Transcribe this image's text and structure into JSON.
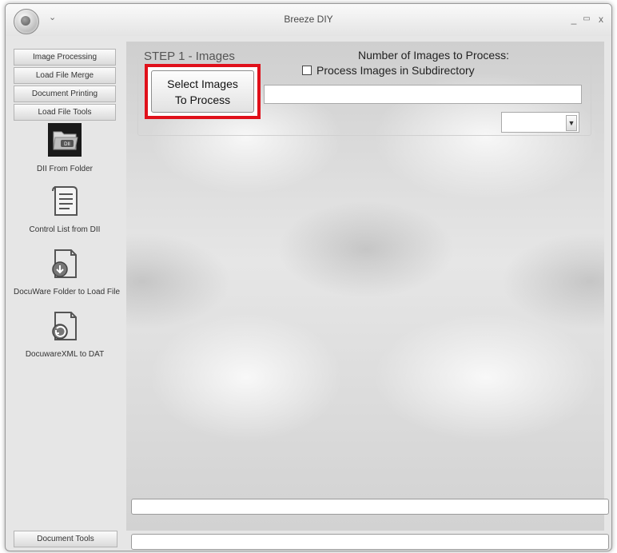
{
  "window": {
    "title": "Breeze DIY",
    "quick_access": "⌄",
    "minimize": "_",
    "maximize": "▭",
    "close": "x"
  },
  "sidebar": {
    "tabs": [
      {
        "label": "Image Processing"
      },
      {
        "label": "Load File Merge"
      },
      {
        "label": "Document Printing"
      },
      {
        "label": "Load File Tools"
      }
    ],
    "tools": [
      {
        "label": "DII From Folder",
        "icon": "dii-folder-icon",
        "folder_text": "DII"
      },
      {
        "label": "Control List from DII",
        "icon": "document-list-icon"
      },
      {
        "label": "DocuWare Folder to Load File",
        "icon": "docuware-download-icon"
      },
      {
        "label": "DocuwareXML to DAT",
        "icon": "docuware-convert-icon"
      }
    ],
    "bottom_tab": "Document Tools"
  },
  "main": {
    "step_label": "STEP 1 - Images",
    "number_label": "Number of Images to Process:",
    "subdir_checkbox": {
      "label": "Process Images in Subdirectory",
      "checked": false
    },
    "select_button": {
      "line1": "Select Images",
      "line2": "To Process"
    },
    "path_value": "",
    "combo_value": "",
    "highlight_color": "#e0101a"
  }
}
